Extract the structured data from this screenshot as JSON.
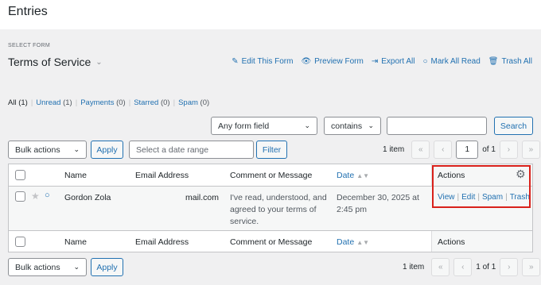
{
  "page": {
    "title": "Entries"
  },
  "form_select": {
    "label": "SELECT FORM",
    "name": "Terms of Service"
  },
  "form_actions": [
    {
      "label": "Edit This Form",
      "icon": "pencil-icon"
    },
    {
      "label": "Preview Form",
      "icon": "eye-icon"
    },
    {
      "label": "Export All",
      "icon": "export-icon"
    },
    {
      "label": "Mark All Read",
      "icon": "circle-icon"
    },
    {
      "label": "Trash All",
      "icon": "trash-icon"
    }
  ],
  "filters": {
    "all": "All",
    "all_count": "(1)",
    "unread": "Unread",
    "unread_count": "(1)",
    "payments": "Payments",
    "payments_count": "(0)",
    "starred": "Starred",
    "starred_count": "(0)",
    "spam": "Spam",
    "spam_count": "(0)"
  },
  "search": {
    "field": "Any form field",
    "operator": "contains",
    "value": "",
    "button": "Search"
  },
  "bulk_top": {
    "select": "Bulk actions",
    "apply": "Apply",
    "date_placeholder": "Select a date range",
    "filter": "Filter"
  },
  "pagination": {
    "count": "1 item",
    "first": "«",
    "prev": "‹",
    "page": "1",
    "of": "of 1",
    "next": "›",
    "last": "»"
  },
  "pagination_bottom": {
    "count": "1 item",
    "first": "«",
    "prev": "‹",
    "page_text": "1 of 1",
    "next": "›",
    "last": "»"
  },
  "table": {
    "headers": {
      "name": "Name",
      "email": "Email Address",
      "comment": "Comment or Message",
      "date": "Date",
      "actions": "Actions"
    },
    "rows": [
      {
        "name": "Gordon Zola",
        "email": "mail.com",
        "comment": "I've read, understood, and agreed to your terms of service.",
        "date": "December 30, 2025 at 2:45 pm",
        "actions": [
          "View",
          "Edit",
          "Spam",
          "Trash"
        ]
      }
    ]
  },
  "bulk_bottom": {
    "select": "Bulk actions",
    "apply": "Apply"
  },
  "colors": {
    "accent": "#2271b1",
    "highlight": "#d9211b"
  }
}
